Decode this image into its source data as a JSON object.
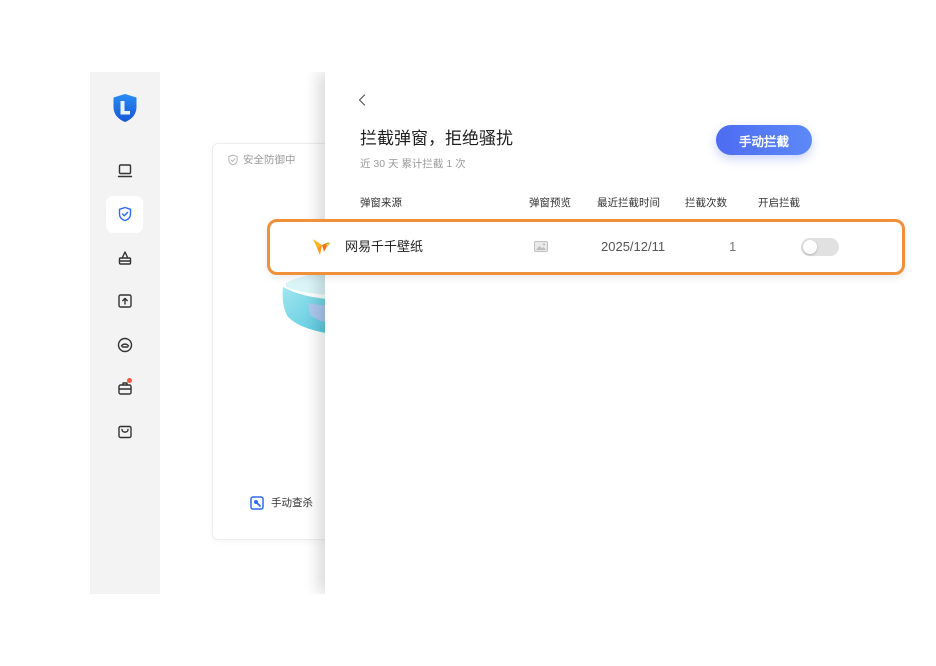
{
  "app": {
    "logo_icon": "shield-logo-icon"
  },
  "sidebar": {
    "items": [
      {
        "icon": "monitor-icon",
        "active": false,
        "badge": false
      },
      {
        "icon": "shield-check-icon",
        "active": true,
        "badge": false
      },
      {
        "icon": "clean-icon",
        "active": false,
        "badge": false
      },
      {
        "icon": "software-box-icon",
        "active": false,
        "badge": false
      },
      {
        "icon": "privacy-icon",
        "active": false,
        "badge": false
      },
      {
        "icon": "toolbox-icon",
        "active": false,
        "badge": true
      },
      {
        "icon": "store-bag-icon",
        "active": false,
        "badge": false
      }
    ]
  },
  "background_card": {
    "status_icon": "shield-check-icon",
    "status_text": "安全防御中",
    "scan_icon": "scan-tool-icon",
    "scan_label": "手动查杀"
  },
  "panel": {
    "back_icon": "chevron-left-icon",
    "title": "拦截弹窗，拒绝骚扰",
    "subtitle": "近 30 天 累计拦截 1 次",
    "manual_block_label": "手动拦截",
    "columns": {
      "source": "弹窗来源",
      "preview": "弹窗预览",
      "last_time": "最近拦截时间",
      "count": "拦截次数",
      "enabled": "开启拦截"
    },
    "rows": [
      {
        "app_icon": "bird-app-icon",
        "source": "网易千千壁纸",
        "preview_icon": "image-icon",
        "last_time": "2025/12/11",
        "count": "1",
        "enabled": false
      }
    ]
  },
  "colors": {
    "accent": "#2f6bf2",
    "button_start": "#4d6cf2",
    "button_end": "#5d89f8",
    "highlight": "#f0913a",
    "badge": "#f25a45",
    "toggle_off": "#e1e1e1",
    "sidebar_bg": "#f3f3f3"
  }
}
